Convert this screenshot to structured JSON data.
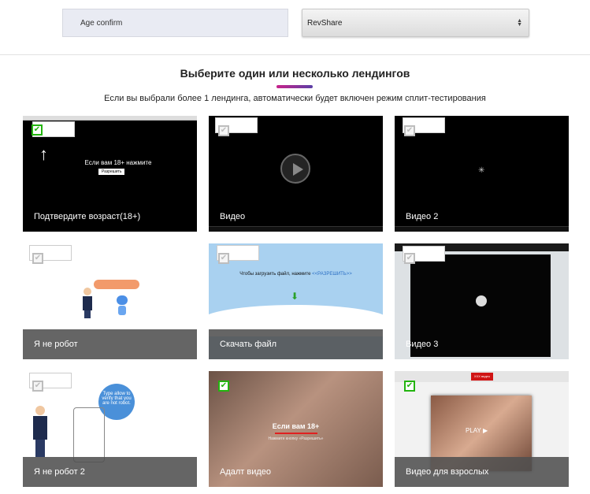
{
  "form": {
    "name_value": "Age confirm",
    "model_value": "RevShare"
  },
  "section": {
    "title": "Выберите один или несколько лендингов",
    "subtitle": "Если вы выбрали более 1 лендинга, автоматически будет включен режим сплит-тестирования"
  },
  "cards": [
    {
      "label": "Подтвердите возраст(18+)",
      "selected": true
    },
    {
      "label": "Видео",
      "selected": false
    },
    {
      "label": "Видео 2",
      "selected": false
    },
    {
      "label": "Я не робот",
      "selected": false
    },
    {
      "label": "Скачать файл",
      "selected": false
    },
    {
      "label": "Видео 3",
      "selected": false
    },
    {
      "label": "Я не робот 2",
      "selected": false
    },
    {
      "label": "Адалт видео",
      "selected": true
    },
    {
      "label": "Видео для взрослых",
      "selected": true
    }
  ],
  "previews": {
    "age_text": "Если вам 18+ нажмите",
    "age_button": "Разрешить",
    "download_text": "Чтобы загрузить файл, нажмите",
    "download_link": "<<РАЗРЕШИТЬ>>",
    "robot2_bubble": "Type allow to verify that you are not robot.",
    "adult_headline": "Если вам 18+",
    "adult_sub": "Нажмите кнопку «Разрешить»",
    "xxx_badge": "XXX видео",
    "xxx_play": "PLAY"
  },
  "colors": {
    "check": "#23b40f",
    "accent_start": "#c8228a",
    "accent_end": "#5b3fa6"
  }
}
